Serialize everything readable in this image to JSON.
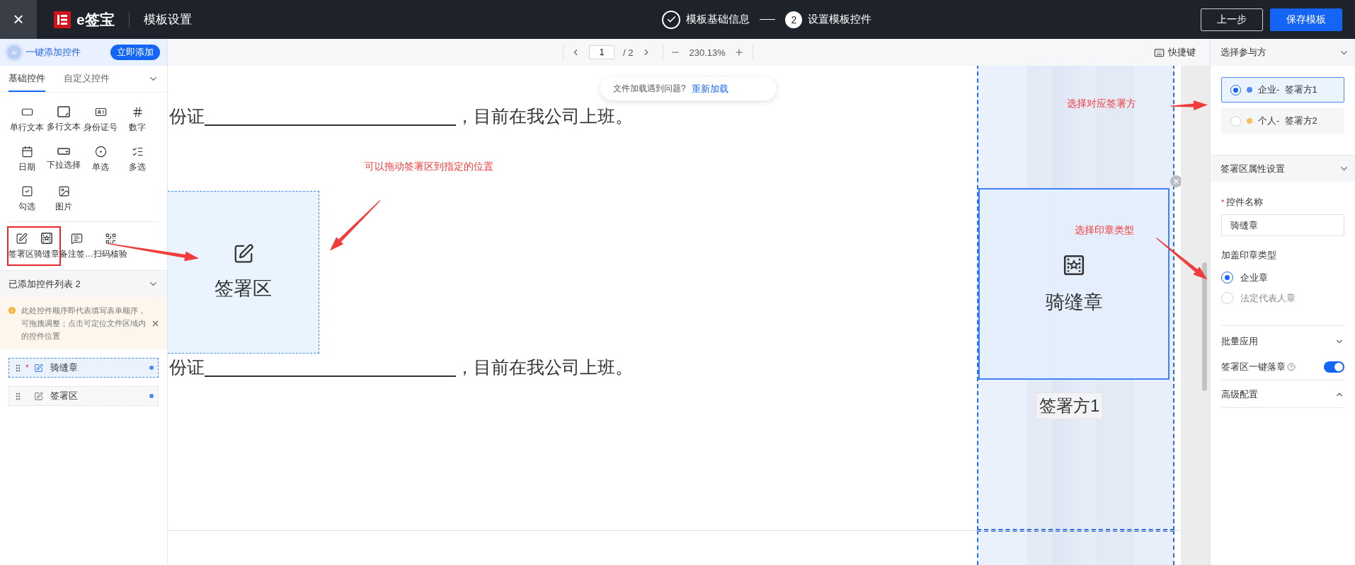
{
  "topbar": {
    "close": "×",
    "logo_text": "e签宝",
    "title": "模板设置",
    "steps": [
      {
        "label": "模板基础信息",
        "done": true
      },
      {
        "number": "2",
        "label": "设置模板控件",
        "done": false
      }
    ],
    "buttons": [
      {
        "label": "上一步",
        "kind": "secondary"
      },
      {
        "label": "保存模板",
        "kind": "primary"
      }
    ]
  },
  "left_panel": {
    "ai_bar": {
      "text": "一键添加控件",
      "button": "立即添加",
      "badge": "AI"
    },
    "tabs": [
      {
        "label": "基础控件",
        "selected": true
      },
      {
        "label": "自定义控件",
        "selected": false
      }
    ],
    "basic_controls": [
      {
        "label": "单行文本",
        "kind": "single_line"
      },
      {
        "label": "多行文本",
        "kind": "multi_line"
      },
      {
        "label": "身份证号",
        "kind": "id_card"
      },
      {
        "label": "数字",
        "kind": "number"
      },
      {
        "label": "日期",
        "kind": "date"
      },
      {
        "label": "下拉选择",
        "kind": "select"
      },
      {
        "label": "单选",
        "kind": "radio"
      },
      {
        "label": "多选",
        "kind": "multi"
      },
      {
        "label": "勾选",
        "kind": "check"
      },
      {
        "label": "图片",
        "kind": "image"
      }
    ],
    "sign_controls": [
      {
        "label": "签署区",
        "kind": "sign",
        "highlighted": true
      },
      {
        "label": "骑缝章",
        "kind": "seal",
        "highlighted": true
      },
      {
        "label": "备注签…",
        "kind": "note",
        "highlighted": false
      },
      {
        "label": "扫码核验",
        "kind": "qr",
        "highlighted": false
      }
    ],
    "added_list": {
      "title": "已添加控件列表 2",
      "notice": "此处控件顺序即代表填写表单顺序，可拖拽调整；点击可定位文件区域内的控件位置",
      "items": [
        {
          "label": "骑缝章",
          "required_mark": "*",
          "selected": true,
          "color": "#4a8af4"
        },
        {
          "label": "签署区",
          "selected": false,
          "color": "#4a8af4"
        }
      ]
    }
  },
  "toolbar": {
    "page": "1",
    "total": "/ 2",
    "zoom": "230.13%",
    "shortcut": "快捷键"
  },
  "document": {
    "notice": "文件加载遇到问题?",
    "reload": "重新加载",
    "lines": [
      {
        "before": "份证",
        "after": "，目前在我公司上班。"
      },
      {
        "before": "份证",
        "after": "，目前在我公司上班。"
      }
    ],
    "sign_field": {
      "label": "签署区"
    },
    "seam_field": {
      "label": "骑缝章",
      "signer": "签署方1"
    },
    "annotations": [
      "可以拖动签署区到指定的位置",
      "选择对应签署方",
      "选择印章类型"
    ]
  },
  "right_panel": {
    "signer_section": {
      "title": "选择参与方",
      "signers": [
        {
          "label": "企业-  签署方1",
          "color": "#4a8af4",
          "selected": true
        },
        {
          "label": "个人-  签署方2",
          "color": "#f8c057",
          "selected": false
        }
      ]
    },
    "props_section": {
      "title": "签署区属性设置",
      "name_label": "控件名称",
      "name_required_mark": "*",
      "name_value": "骑缝章",
      "seal_type_label": "加盖印章类型",
      "seal_types": [
        {
          "label": "企业章",
          "selected": true
        },
        {
          "label": "法定代表人章",
          "selected": false
        }
      ],
      "batch": {
        "title": "批量应用",
        "expanded": false
      },
      "toggle": {
        "label": "签署区一键落章",
        "on": true
      },
      "advanced": {
        "title": "高级配置",
        "expanded": true
      }
    }
  }
}
